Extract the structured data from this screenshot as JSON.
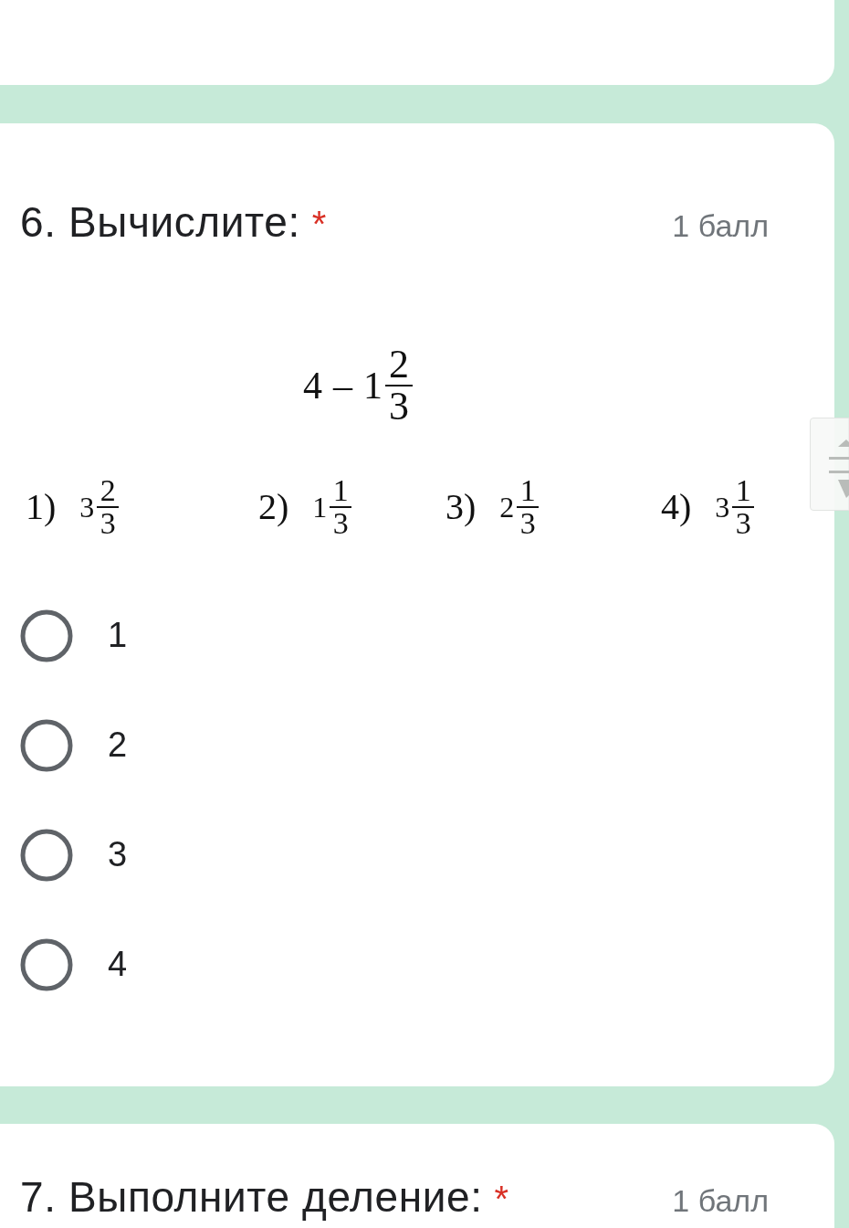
{
  "question": {
    "title": "6. Вычислите:",
    "required_mark": "*",
    "points": "1 балл",
    "expression": {
      "minuend": "4",
      "operator": "–",
      "subtrahend": {
        "whole": "1",
        "numerator": "2",
        "denominator": "3"
      }
    },
    "choices": [
      {
        "label": "1)",
        "whole": "3",
        "numerator": "2",
        "denominator": "3"
      },
      {
        "label": "2)",
        "whole": "1",
        "numerator": "1",
        "denominator": "3"
      },
      {
        "label": "3)",
        "whole": "2",
        "numerator": "1",
        "denominator": "3"
      },
      {
        "label": "4)",
        "whole": "3",
        "numerator": "1",
        "denominator": "3"
      }
    ],
    "options": [
      {
        "label": "1",
        "selected": false
      },
      {
        "label": "2",
        "selected": false
      },
      {
        "label": "3",
        "selected": false
      },
      {
        "label": "4",
        "selected": false
      }
    ]
  },
  "next_question": {
    "title": "7. Выполните деление:",
    "required_mark": "*",
    "points": "1 балл"
  }
}
